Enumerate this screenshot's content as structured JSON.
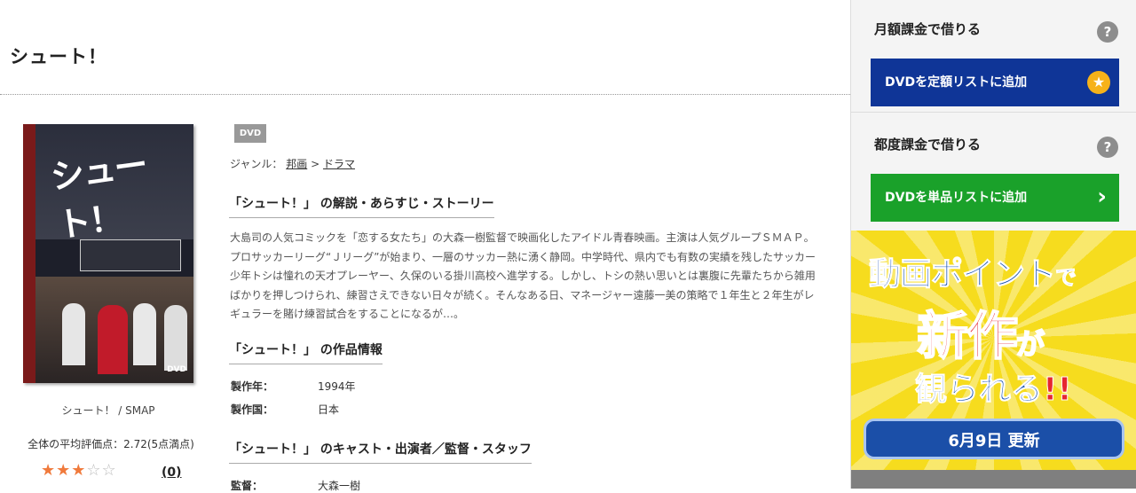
{
  "page": {
    "title": "シュート！"
  },
  "product": {
    "format_badge": "DVD",
    "genre_label": "ジャンル：",
    "genre": "邦画",
    "genre_sep": ">",
    "subgenre": "ドラマ",
    "cover_caption": "シュート！ / SMAP",
    "avg_rating_text": "全体の平均評価点：2.72(5点満点)",
    "stars": {
      "filled": "★★★",
      "empty": "☆☆"
    },
    "review_count": "(0)",
    "cover": {
      "logo": "シュート！",
      "dvd_mark": "DVD"
    }
  },
  "synopsis": {
    "heading": "「シュート！」 の解説・あらすじ・ストーリー",
    "text": "大島司の人気コミックを「恋する女たち」の大森一樹監督で映画化したアイドル青春映画。主演は人気グループＳＭＡＰ。プロサッカーリーグ“Ｊリーグ”が始まり、一層のサッカー熱に湧く静岡。中学時代、県内でも有数の実績を残したサッカー少年トシは憧れの天才プレーヤー、久保のいる掛川高校へ進学する。しかし、トシの熱い思いとは裏腹に先輩たちから雑用ばかりを押しつけられ、練習さえできない日々が続く。そんなある日、マネージャー遠藤一美の策略で１年生と２年生がレギュラーを賭け練習試合をすることになるが…。"
  },
  "work_info": {
    "heading": "「シュート！」 の作品情報",
    "rows": [
      {
        "label": "製作年：",
        "value": "1994年"
      },
      {
        "label": "製作国：",
        "value": "日本"
      }
    ]
  },
  "cast": {
    "heading": "「シュート！」 のキャスト・出演者／監督・スタッフ",
    "rows": [
      {
        "label": "監督：",
        "value": "大森一樹"
      }
    ]
  },
  "sidebar": {
    "monthly": {
      "title": "月額課金で借りる",
      "help": "?",
      "button": "DVDを定額リストに追加",
      "button_icon": "★"
    },
    "per_rental": {
      "title": "都度課金で借りる",
      "help": "?",
      "button": "DVDを単品リストに追加",
      "button_icon": "›"
    },
    "banner": {
      "line1": "動画ポイント",
      "line1_small": "で",
      "line2": "新作",
      "line2_small": "が",
      "line3": "観られる",
      "line3_ex": "!!",
      "update": "6月9日 更新"
    },
    "colors": {
      "blue_button": "#0f3597",
      "green_button": "#1aa12a",
      "banner_bg": "#f6dc1e"
    }
  }
}
